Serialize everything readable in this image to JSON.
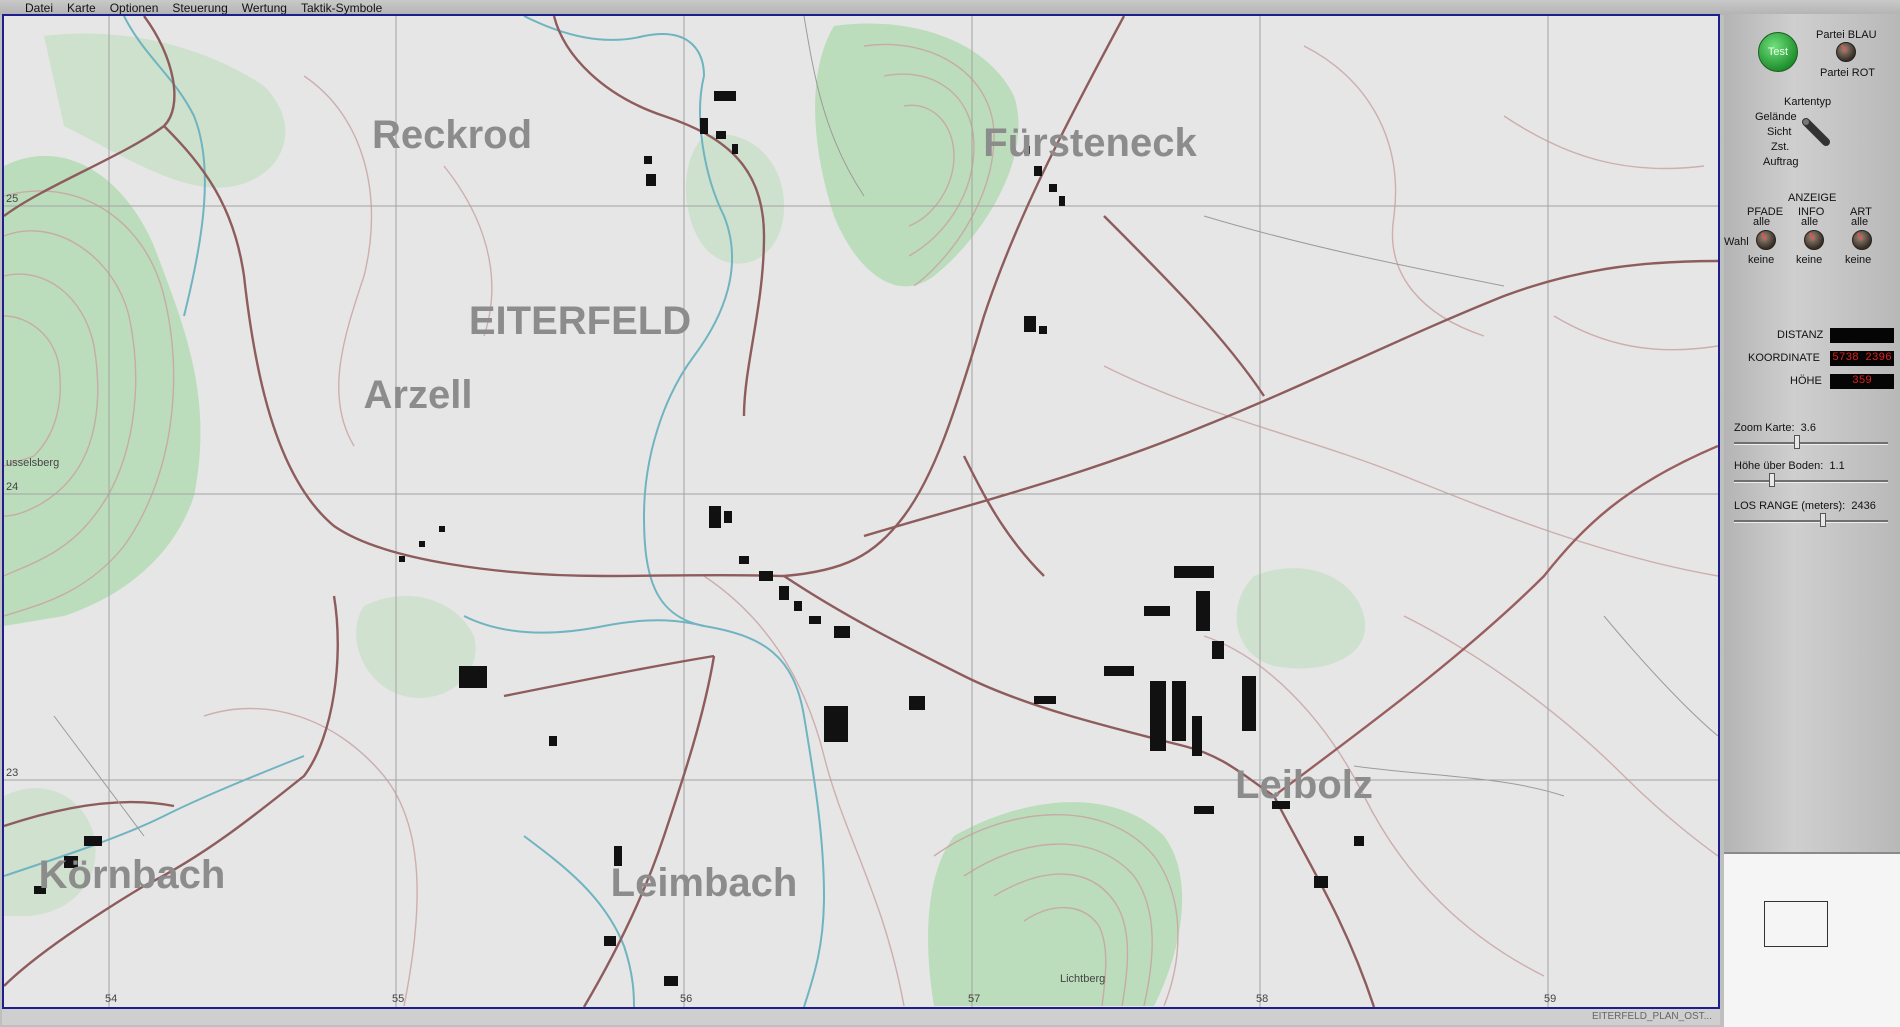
{
  "menu": [
    "Datei",
    "Karte",
    "Optionen",
    "Steuerung",
    "Wertung",
    "Taktik-Symbole"
  ],
  "map": {
    "towns": [
      {
        "name": "Reckrod",
        "key": "reckrod"
      },
      {
        "name": "Fürsteneck",
        "key": "fuersteneck"
      },
      {
        "name": "EITERFELD",
        "key": "eiterfeld"
      },
      {
        "name": "Arzell",
        "key": "arzell"
      },
      {
        "name": "Körnbach",
        "key": "koernbach"
      },
      {
        "name": "Leimbach",
        "key": "leimbach"
      },
      {
        "name": "Leibolz",
        "key": "leibolz"
      }
    ],
    "small_labels": {
      "hill1": "usselsberg",
      "hill2": "Lichtberg"
    },
    "grid_x": [
      "54",
      "55",
      "56",
      "57",
      "58",
      "59"
    ],
    "grid_y": [
      "25",
      "24",
      "23"
    ],
    "footer": "EITERFELD_PLAN_OST..."
  },
  "panel": {
    "test": "Test",
    "party_blue": "Partei BLAU",
    "party_red": "Partei ROT",
    "map_type_title": "Kartentyp",
    "map_type_options": [
      "Gelände",
      "Sicht",
      "Zst.",
      "Auftrag"
    ],
    "display_title": "ANZEIGE",
    "display_cols": [
      {
        "title": "PFADE",
        "top": "alle",
        "bottom": "keine"
      },
      {
        "title": "INFO",
        "top": "alle",
        "bottom": "keine"
      },
      {
        "title": "ART",
        "top": "alle",
        "bottom": "keine"
      }
    ],
    "wahl": "Wahl",
    "distance_label": "DISTANZ",
    "distance_value": "",
    "coord_label": "KOORDINATE",
    "coord_value": "5738 2396",
    "height_label": "HÖHE",
    "height_value": "359",
    "zoom": {
      "label": "Zoom Karte:",
      "value": "3.6",
      "fraction": 0.4
    },
    "hob": {
      "label": "Höhe über Boden:",
      "value": "1.1",
      "fraction": 0.23
    },
    "los": {
      "label": "LOS RANGE (meters):",
      "value": "2436",
      "fraction": 0.57
    }
  },
  "colors": {
    "map_bg": "#e6e6e6",
    "forest": "#a9d9a9",
    "road": "#8c5a5a",
    "river": "#5aa8b4",
    "contour": "#c49999",
    "grid": "#9a9a9a"
  }
}
